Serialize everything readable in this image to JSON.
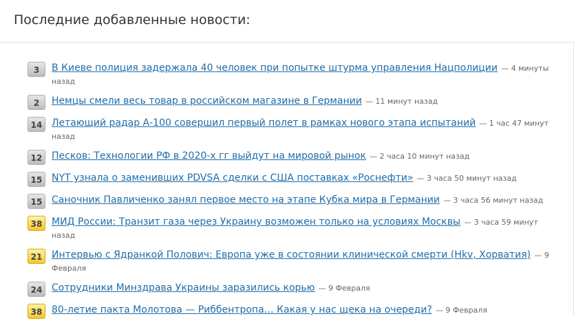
{
  "header": {
    "title": "Последние добавленные новости:"
  },
  "news": [
    {
      "count": "3",
      "title": "В Киеве полиция задержала 40 человек при попытке штурма управления Нацполиции",
      "time": "— 4 минуты назад",
      "badge": "gray"
    },
    {
      "count": "2",
      "title": "Немцы смели весь товар в российском магазине в Германии",
      "time": "— 11 минут назад",
      "badge": "gray"
    },
    {
      "count": "14",
      "title": "Летающий радар А-100 совершил первый полет в рамках нового этапа испытаний",
      "time": "— 1 час 47 минут назад",
      "badge": "gray"
    },
    {
      "count": "12",
      "title": "Песков: Технологии РФ в 2020-х гг выйдут на мировой рынок",
      "time": "— 2 часа 10 минут назад",
      "badge": "gray"
    },
    {
      "count": "15",
      "title": "NYT узнала о заменивших PDVSA сделки с США поставках «Роснефти»",
      "time": "— 3 часа 50 минут назад",
      "badge": "gray"
    },
    {
      "count": "15",
      "title": "Саночник Павличенко занял первое место на этапе Кубка мира в Германии",
      "time": "— 3 часа 56 минут назад",
      "badge": "gray"
    },
    {
      "count": "38",
      "title": "МИД России: Транзит газа через Украину возможен только на условиях Москвы",
      "time": "— 3 часа 59 минут назад",
      "badge": "yellow"
    },
    {
      "count": "21",
      "title": "Интервью с Ядранкой Полович: Европа уже в состоянии клинической смерти (Hkv, Хорватия)",
      "time": "— 9 Февраля",
      "badge": "yellow"
    },
    {
      "count": "24",
      "title": "Сотрудники Минздрава Украины заразились корью",
      "time": "— 9 Февраля",
      "badge": "gray"
    },
    {
      "count": "38",
      "title": "80-летие пакта Молотова — Риббентропа… Какая у нас щека на очереди?",
      "time": "— 9 Февраля",
      "badge": "yellow"
    }
  ]
}
